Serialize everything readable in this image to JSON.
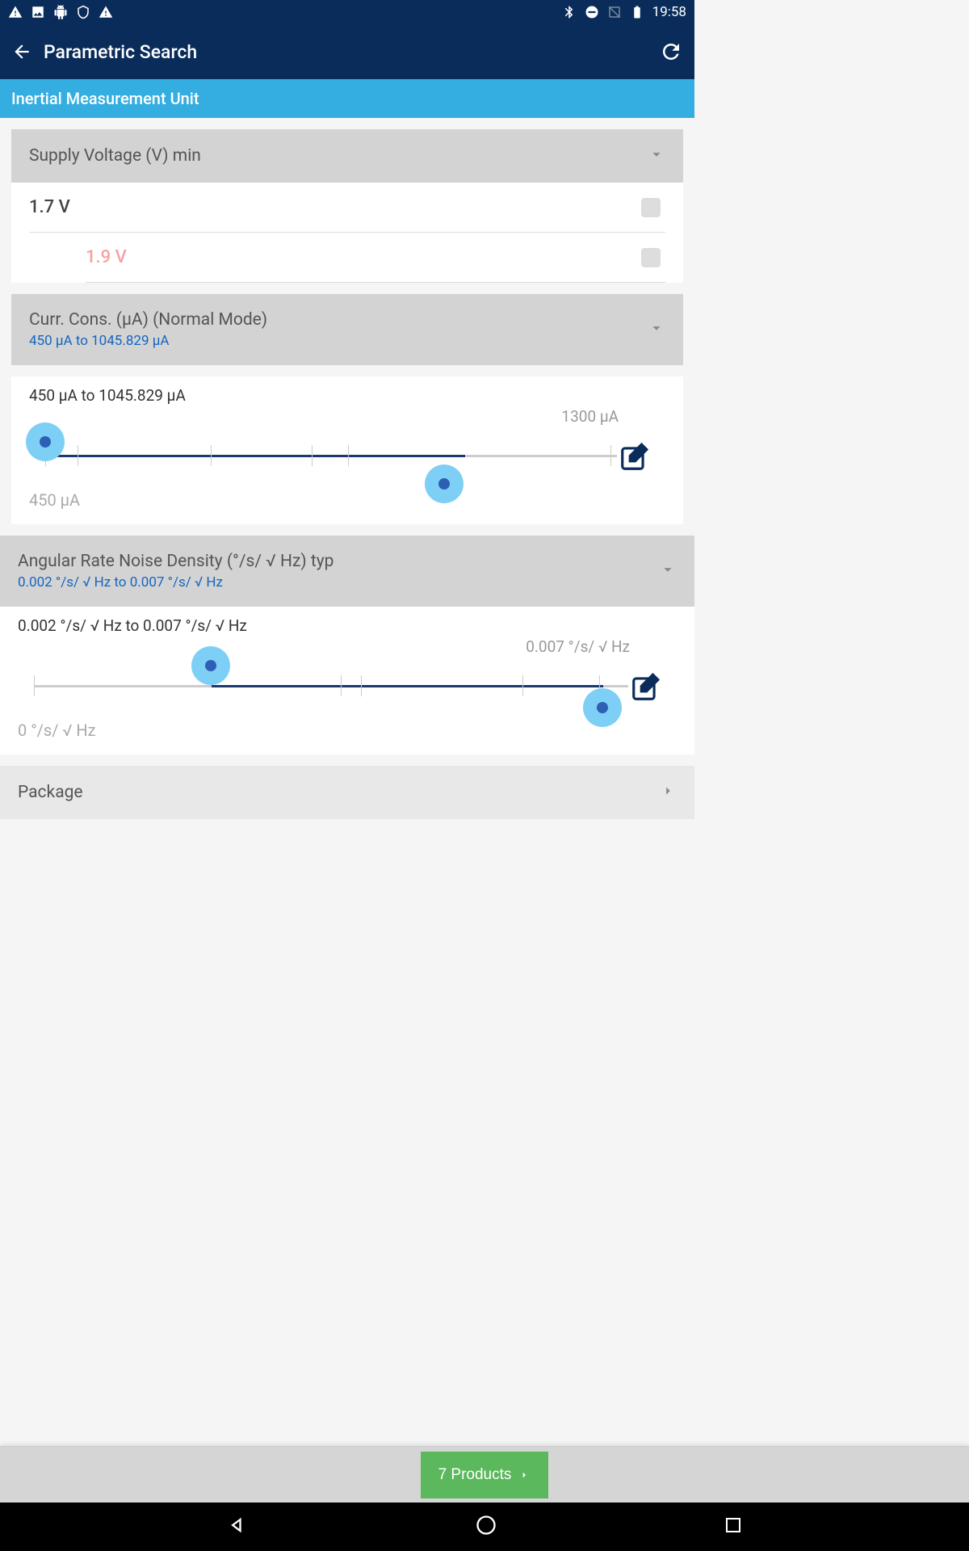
{
  "status": {
    "time": "19:58"
  },
  "appbar": {
    "title": "Parametric Search"
  },
  "category": {
    "title": "Inertial Measurement Unit"
  },
  "filters": {
    "supplyVoltage": {
      "title": "Supply Voltage (V) min",
      "options": [
        {
          "label": "1.7 V",
          "faded": false
        },
        {
          "label": "1.9 V",
          "faded": true
        }
      ]
    },
    "currCons": {
      "title": "Curr. Cons. (µA) (Normal Mode)",
      "subtitle": "450 µA to 1045.829 µA",
      "rangeLabel": "450 µA to 1045.829 µA",
      "maxLabel": "1300 µA",
      "minLabel": "450 µA"
    },
    "angularRate": {
      "title": "Angular Rate Noise Density (°/s/ √ Hz) typ",
      "subtitle": "0.002 °/s/ √ Hz to 0.007 °/s/ √ Hz",
      "rangeLabel": "0.002 °/s/ √ Hz to 0.007 °/s/ √ Hz",
      "maxLabel": "0.007 °/s/ √ Hz",
      "minLabel": "0 °/s/ √ Hz"
    },
    "package": {
      "title": "Package"
    }
  },
  "bottom": {
    "productsLabel": "7 Products"
  }
}
